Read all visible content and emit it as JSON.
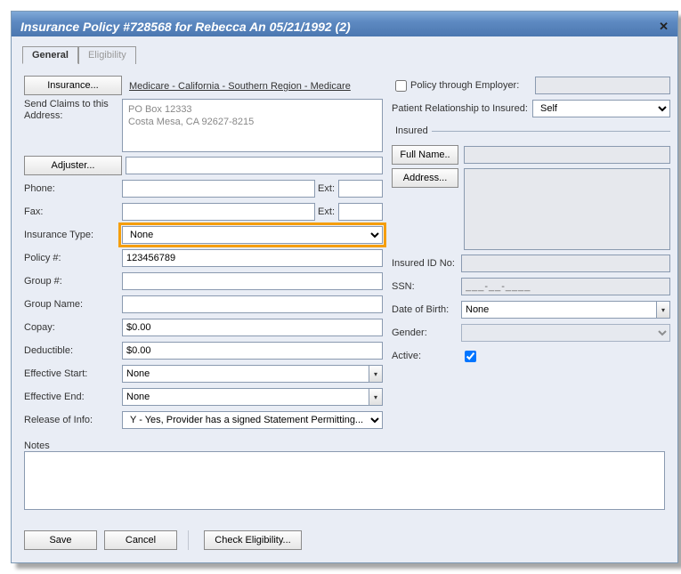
{
  "title": "Insurance Policy #728568 for Rebecca An 05/21/1992 (2)",
  "tabs": {
    "general": "General",
    "eligibility": "Eligibility"
  },
  "left": {
    "insurance_btn": "Insurance...",
    "insurance_link": "Medicare - California - Southern Region - Medicare",
    "send_claims_lbl": "Send Claims to this Address:",
    "address_line1": "PO Box 12333",
    "address_line2": "Costa Mesa, CA 92627-8215",
    "adjuster_btn": "Adjuster...",
    "adjuster_val": "",
    "phone_lbl": "Phone:",
    "phone_val": "",
    "ext_lbl": "Ext:",
    "phone_ext": "",
    "fax_lbl": "Fax:",
    "fax_val": "",
    "fax_ext": "",
    "ins_type_lbl": "Insurance Type:",
    "ins_type_val": "None",
    "policy_lbl": "Policy #:",
    "policy_val": "123456789",
    "group_lbl": "Group #:",
    "group_val": "",
    "groupname_lbl": "Group Name:",
    "groupname_val": "",
    "copay_lbl": "Copay:",
    "copay_val": "$0.00",
    "deductible_lbl": "Deductible:",
    "deductible_val": "$0.00",
    "effstart_lbl": "Effective Start:",
    "effstart_val": "None",
    "effend_lbl": "Effective End:",
    "effend_val": "None",
    "release_lbl": "Release of Info:",
    "release_val": "Y - Yes, Provider has a signed Statement Permitting..."
  },
  "right": {
    "pte_chk_lbl": "Policy through Employer:",
    "pte_val": "",
    "rel_lbl": "Patient Relationship to Insured:",
    "rel_val": "Self",
    "insured_legend": "Insured",
    "fullname_btn": "Full Name..",
    "fullname_val": "",
    "address_btn": "Address...",
    "insid_lbl": "Insured ID No:",
    "insid_val": "",
    "ssn_lbl": "SSN:",
    "ssn_val": "___-__-____",
    "dob_lbl": "Date of Birth:",
    "dob_val": "None",
    "gender_lbl": "Gender:",
    "gender_val": "",
    "active_lbl": "Active:",
    "active_checked": true
  },
  "notes_lbl": "Notes",
  "notes_val": "",
  "buttons": {
    "save": "Save",
    "cancel": "Cancel",
    "check": "Check Eligibility..."
  }
}
